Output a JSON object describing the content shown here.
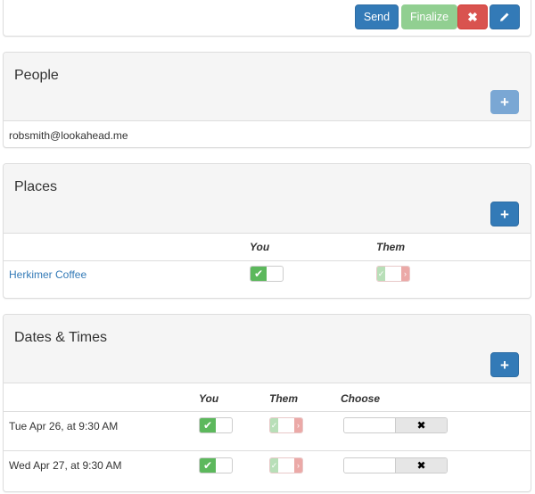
{
  "toolbar": {
    "send_label": "Send",
    "finalize_label": "Finalize",
    "delete_icon": "times-icon",
    "edit_icon": "pencil-icon"
  },
  "people": {
    "title": "People",
    "add_icon": "plus-icon",
    "items": [
      "robsmith@lookahead.me"
    ]
  },
  "places": {
    "title": "Places",
    "add_icon": "plus-icon",
    "col_you": "You",
    "col_them": "Them",
    "rows": [
      {
        "name": "Herkimer Coffee",
        "you": "check-icon",
        "them": "split-toggle"
      }
    ]
  },
  "dates": {
    "title": "Dates & Times",
    "add_icon": "plus-icon",
    "col_you": "You",
    "col_them": "Them",
    "col_choose": "Choose",
    "rows": [
      {
        "label": "Tue Apr 26, at 9:30 AM",
        "choose_icon": "✖"
      },
      {
        "label": "Wed Apr 27, at 9:30 AM",
        "choose_icon": "✖"
      }
    ]
  },
  "colors": {
    "primary": "#337ab7",
    "success": "#5cb85c",
    "danger": "#d9534f",
    "link": "#337ab7"
  }
}
